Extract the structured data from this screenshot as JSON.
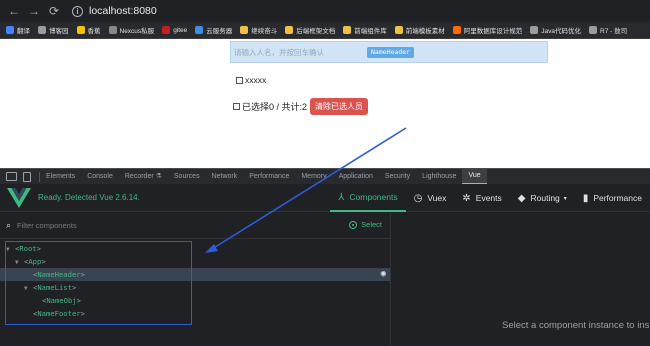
{
  "browser": {
    "url": "localhost:8080",
    "bookmarks": [
      {
        "label": "翻译",
        "color": "#4285f4"
      },
      {
        "label": "博客园",
        "color": "#9c9c9c"
      },
      {
        "label": "香蕉",
        "color": "#f4c20d"
      },
      {
        "label": "Nexcus私服",
        "color": "#888888"
      },
      {
        "label": "gitee",
        "color": "#c71d23"
      },
      {
        "label": "云服务器",
        "color": "#3b8eea"
      },
      {
        "label": "继续奋斗",
        "color": "#f0c040"
      },
      {
        "label": "后端框架文档",
        "color": "#f0c040"
      },
      {
        "label": "前端组件库",
        "color": "#f0c040"
      },
      {
        "label": "前端模板素材",
        "color": "#f0c040"
      },
      {
        "label": "阿里数据库设计规范",
        "color": "#ff6a00"
      },
      {
        "label": "Java代码优化",
        "color": "#9c9c9c"
      },
      {
        "label": "R7 - 敖司",
        "color": "#9c9c9c"
      }
    ]
  },
  "app": {
    "name_input_placeholder": "请输入人名，并按回车确认",
    "header_tag": "NameHeader",
    "obj_label": "xxxxx",
    "footer_text": "已选择0 / 共计:2",
    "clear_button": "清除已选人员"
  },
  "devtools": {
    "tabs": [
      {
        "label": "Elements",
        "active": false
      },
      {
        "label": "Console",
        "active": false
      },
      {
        "label": "Recorder ⚗",
        "active": false
      },
      {
        "label": "Sources",
        "active": false
      },
      {
        "label": "Network",
        "active": false
      },
      {
        "label": "Performance",
        "active": false
      },
      {
        "label": "Memory",
        "active": false
      },
      {
        "label": "Application",
        "active": false
      },
      {
        "label": "Security",
        "active": false
      },
      {
        "label": "Lighthouse",
        "active": false
      },
      {
        "label": "Vue",
        "active": true
      }
    ],
    "vue": {
      "status": "Ready. Detected Vue 2.6.14.",
      "nav": [
        {
          "label": "Components",
          "icon": "⅄",
          "active": true
        },
        {
          "label": "Vuex",
          "icon": "◷",
          "active": false
        },
        {
          "label": "Events",
          "icon": "✲",
          "active": false
        },
        {
          "label": "Routing",
          "icon": "◆",
          "active": false,
          "dropdown": true
        },
        {
          "label": "Performance",
          "icon": "▮",
          "active": false,
          "dropdown": false
        }
      ],
      "filter_placeholder": "Filter components",
      "select_label": "Select",
      "tree": [
        {
          "name": "Root",
          "depth": 0,
          "arrow": "▼",
          "selected": false
        },
        {
          "name": "App",
          "depth": 1,
          "arrow": "▼",
          "selected": false
        },
        {
          "name": "NameHeader",
          "depth": 2,
          "arrow": "",
          "selected": true
        },
        {
          "name": "NameList",
          "depth": 2,
          "arrow": "▼",
          "selected": false
        },
        {
          "name": "NameObj",
          "depth": 3,
          "arrow": "",
          "selected": false
        },
        {
          "name": "NameFooter",
          "depth": 2,
          "arrow": "",
          "selected": false
        }
      ],
      "empty_message": "Select a component instance to inspect"
    }
  },
  "colors": {
    "vue_green": "#42b883",
    "annotation_blue": "#2f5bd8",
    "clear_button_red": "#d9534f"
  }
}
